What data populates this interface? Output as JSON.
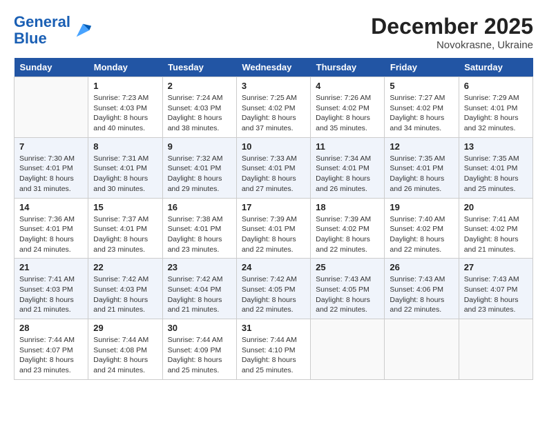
{
  "header": {
    "logo_line1": "General",
    "logo_line2": "Blue",
    "month": "December 2025",
    "location": "Novokrasne, Ukraine"
  },
  "weekdays": [
    "Sunday",
    "Monday",
    "Tuesday",
    "Wednesday",
    "Thursday",
    "Friday",
    "Saturday"
  ],
  "weeks": [
    [
      {
        "day": "",
        "sunrise": "",
        "sunset": "",
        "daylight": ""
      },
      {
        "day": "1",
        "sunrise": "7:23 AM",
        "sunset": "4:03 PM",
        "daylight": "8 hours and 40 minutes."
      },
      {
        "day": "2",
        "sunrise": "7:24 AM",
        "sunset": "4:03 PM",
        "daylight": "8 hours and 38 minutes."
      },
      {
        "day": "3",
        "sunrise": "7:25 AM",
        "sunset": "4:02 PM",
        "daylight": "8 hours and 37 minutes."
      },
      {
        "day": "4",
        "sunrise": "7:26 AM",
        "sunset": "4:02 PM",
        "daylight": "8 hours and 35 minutes."
      },
      {
        "day": "5",
        "sunrise": "7:27 AM",
        "sunset": "4:02 PM",
        "daylight": "8 hours and 34 minutes."
      },
      {
        "day": "6",
        "sunrise": "7:29 AM",
        "sunset": "4:01 PM",
        "daylight": "8 hours and 32 minutes."
      }
    ],
    [
      {
        "day": "7",
        "sunrise": "7:30 AM",
        "sunset": "4:01 PM",
        "daylight": "8 hours and 31 minutes."
      },
      {
        "day": "8",
        "sunrise": "7:31 AM",
        "sunset": "4:01 PM",
        "daylight": "8 hours and 30 minutes."
      },
      {
        "day": "9",
        "sunrise": "7:32 AM",
        "sunset": "4:01 PM",
        "daylight": "8 hours and 29 minutes."
      },
      {
        "day": "10",
        "sunrise": "7:33 AM",
        "sunset": "4:01 PM",
        "daylight": "8 hours and 27 minutes."
      },
      {
        "day": "11",
        "sunrise": "7:34 AM",
        "sunset": "4:01 PM",
        "daylight": "8 hours and 26 minutes."
      },
      {
        "day": "12",
        "sunrise": "7:35 AM",
        "sunset": "4:01 PM",
        "daylight": "8 hours and 26 minutes."
      },
      {
        "day": "13",
        "sunrise": "7:35 AM",
        "sunset": "4:01 PM",
        "daylight": "8 hours and 25 minutes."
      }
    ],
    [
      {
        "day": "14",
        "sunrise": "7:36 AM",
        "sunset": "4:01 PM",
        "daylight": "8 hours and 24 minutes."
      },
      {
        "day": "15",
        "sunrise": "7:37 AM",
        "sunset": "4:01 PM",
        "daylight": "8 hours and 23 minutes."
      },
      {
        "day": "16",
        "sunrise": "7:38 AM",
        "sunset": "4:01 PM",
        "daylight": "8 hours and 23 minutes."
      },
      {
        "day": "17",
        "sunrise": "7:39 AM",
        "sunset": "4:01 PM",
        "daylight": "8 hours and 22 minutes."
      },
      {
        "day": "18",
        "sunrise": "7:39 AM",
        "sunset": "4:02 PM",
        "daylight": "8 hours and 22 minutes."
      },
      {
        "day": "19",
        "sunrise": "7:40 AM",
        "sunset": "4:02 PM",
        "daylight": "8 hours and 22 minutes."
      },
      {
        "day": "20",
        "sunrise": "7:41 AM",
        "sunset": "4:02 PM",
        "daylight": "8 hours and 21 minutes."
      }
    ],
    [
      {
        "day": "21",
        "sunrise": "7:41 AM",
        "sunset": "4:03 PM",
        "daylight": "8 hours and 21 minutes."
      },
      {
        "day": "22",
        "sunrise": "7:42 AM",
        "sunset": "4:03 PM",
        "daylight": "8 hours and 21 minutes."
      },
      {
        "day": "23",
        "sunrise": "7:42 AM",
        "sunset": "4:04 PM",
        "daylight": "8 hours and 21 minutes."
      },
      {
        "day": "24",
        "sunrise": "7:42 AM",
        "sunset": "4:05 PM",
        "daylight": "8 hours and 22 minutes."
      },
      {
        "day": "25",
        "sunrise": "7:43 AM",
        "sunset": "4:05 PM",
        "daylight": "8 hours and 22 minutes."
      },
      {
        "day": "26",
        "sunrise": "7:43 AM",
        "sunset": "4:06 PM",
        "daylight": "8 hours and 22 minutes."
      },
      {
        "day": "27",
        "sunrise": "7:43 AM",
        "sunset": "4:07 PM",
        "daylight": "8 hours and 23 minutes."
      }
    ],
    [
      {
        "day": "28",
        "sunrise": "7:44 AM",
        "sunset": "4:07 PM",
        "daylight": "8 hours and 23 minutes."
      },
      {
        "day": "29",
        "sunrise": "7:44 AM",
        "sunset": "4:08 PM",
        "daylight": "8 hours and 24 minutes."
      },
      {
        "day": "30",
        "sunrise": "7:44 AM",
        "sunset": "4:09 PM",
        "daylight": "8 hours and 25 minutes."
      },
      {
        "day": "31",
        "sunrise": "7:44 AM",
        "sunset": "4:10 PM",
        "daylight": "8 hours and 25 minutes."
      },
      {
        "day": "",
        "sunrise": "",
        "sunset": "",
        "daylight": ""
      },
      {
        "day": "",
        "sunrise": "",
        "sunset": "",
        "daylight": ""
      },
      {
        "day": "",
        "sunrise": "",
        "sunset": "",
        "daylight": ""
      }
    ]
  ]
}
